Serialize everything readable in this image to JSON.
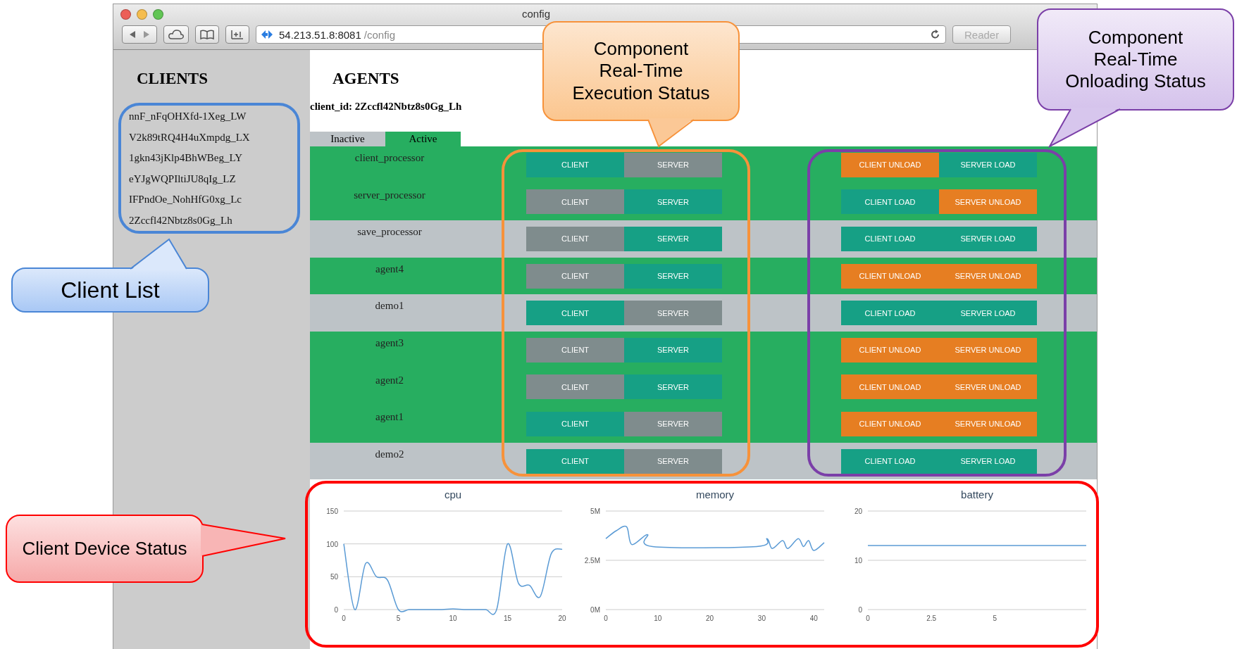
{
  "window": {
    "title": "config",
    "url_host": "54.213.51.8:8081",
    "url_path": "/config",
    "reader": "Reader"
  },
  "clients": {
    "heading": "CLIENTS",
    "items": [
      "nnF_nFqOHXfd-1Xeg_LW",
      "V2k89tRQ4H4uXmpdg_LX",
      "1gkn43jKlp4BhWBeg_LY",
      "eYJgWQPIltiJU8qIg_LZ",
      "IFPndOe_NohHfG0xg_Lc",
      "2Zccfl42Nbtz8s0Gg_Lh"
    ]
  },
  "agents": {
    "heading": "AGENTS",
    "client_id": "client_id: 2Zccfl42Nbtz8s0Gg_Lh",
    "tabs": [
      {
        "label": "Inactive",
        "selected": false
      },
      {
        "label": "Active",
        "selected": true
      }
    ],
    "rows": [
      {
        "name": "client_processor",
        "active": true,
        "execution": [
          {
            "label": "CLIENT",
            "selected": true
          },
          {
            "label": "SERVER",
            "selected": false
          }
        ],
        "onloading": [
          {
            "label": "CLIENT UNLOAD",
            "kind": "unload"
          },
          {
            "label": "SERVER LOAD",
            "kind": "load"
          }
        ]
      },
      {
        "name": "server_processor",
        "active": true,
        "execution": [
          {
            "label": "CLIENT",
            "selected": false
          },
          {
            "label": "SERVER",
            "selected": true
          }
        ],
        "onloading": [
          {
            "label": "CLIENT LOAD",
            "kind": "load"
          },
          {
            "label": "SERVER UNLOAD",
            "kind": "unload"
          }
        ]
      },
      {
        "name": "save_processor",
        "active": false,
        "execution": [
          {
            "label": "CLIENT",
            "selected": false
          },
          {
            "label": "SERVER",
            "selected": true
          }
        ],
        "onloading": [
          {
            "label": "CLIENT LOAD",
            "kind": "load"
          },
          {
            "label": "SERVER LOAD",
            "kind": "load"
          }
        ]
      },
      {
        "name": "agent4",
        "active": true,
        "execution": [
          {
            "label": "CLIENT",
            "selected": false
          },
          {
            "label": "SERVER",
            "selected": true
          }
        ],
        "onloading": [
          {
            "label": "CLIENT UNLOAD",
            "kind": "unload"
          },
          {
            "label": "SERVER UNLOAD",
            "kind": "unload"
          }
        ]
      },
      {
        "name": "demo1",
        "active": false,
        "execution": [
          {
            "label": "CLIENT",
            "selected": true
          },
          {
            "label": "SERVER",
            "selected": false
          }
        ],
        "onloading": [
          {
            "label": "CLIENT LOAD",
            "kind": "load"
          },
          {
            "label": "SERVER LOAD",
            "kind": "load"
          }
        ]
      },
      {
        "name": "agent3",
        "active": true,
        "execution": [
          {
            "label": "CLIENT",
            "selected": false
          },
          {
            "label": "SERVER",
            "selected": true
          }
        ],
        "onloading": [
          {
            "label": "CLIENT UNLOAD",
            "kind": "unload"
          },
          {
            "label": "SERVER UNLOAD",
            "kind": "unload"
          }
        ]
      },
      {
        "name": "agent2",
        "active": true,
        "execution": [
          {
            "label": "CLIENT",
            "selected": false
          },
          {
            "label": "SERVER",
            "selected": true
          }
        ],
        "onloading": [
          {
            "label": "CLIENT UNLOAD",
            "kind": "unload"
          },
          {
            "label": "SERVER UNLOAD",
            "kind": "unload"
          }
        ]
      },
      {
        "name": "agent1",
        "active": true,
        "execution": [
          {
            "label": "CLIENT",
            "selected": true
          },
          {
            "label": "SERVER",
            "selected": false
          }
        ],
        "onloading": [
          {
            "label": "CLIENT UNLOAD",
            "kind": "unload"
          },
          {
            "label": "SERVER UNLOAD",
            "kind": "unload"
          }
        ]
      },
      {
        "name": "demo2",
        "active": false,
        "execution": [
          {
            "label": "CLIENT",
            "selected": true
          },
          {
            "label": "SERVER",
            "selected": false
          }
        ],
        "onloading": [
          {
            "label": "CLIENT LOAD",
            "kind": "load"
          },
          {
            "label": "SERVER LOAD",
            "kind": "load"
          }
        ]
      }
    ]
  },
  "charts": [
    {
      "chart_data": {
        "type": "line",
        "title": "cpu",
        "x": [
          0,
          1,
          2,
          3,
          4,
          5,
          6,
          7,
          8,
          9,
          10,
          11,
          12,
          13,
          14,
          15,
          16,
          17,
          18,
          19,
          20
        ],
        "series": [
          {
            "color": "#5b9bd5",
            "values": [
              100,
              0,
              70,
              50,
              45,
              0,
              0,
              0,
              0,
              0,
              1,
              0,
              0,
              0,
              0,
              100,
              40,
              37,
              20,
              85,
              92
            ]
          }
        ],
        "xlim": [
          0,
          20
        ],
        "ylim": [
          0,
          150
        ],
        "xticks": [
          0,
          5,
          10,
          15,
          20
        ],
        "yticks": [
          0,
          50,
          100,
          150
        ]
      }
    },
    {
      "chart_data": {
        "type": "line",
        "title": "memory",
        "x": [
          0,
          2,
          4,
          5,
          8,
          9,
          29,
          31,
          32,
          34,
          35,
          37,
          38,
          39,
          40,
          42
        ],
        "series": [
          {
            "color": "#5b9bd5",
            "values": [
              3.6,
              4.0,
              4.2,
              3.3,
              3.8,
              3.2,
              3.2,
              3.6,
              3.1,
              3.5,
              3.1,
              3.6,
              3.2,
              3.5,
              3.0,
              3.4
            ]
          }
        ],
        "xlim": [
          0,
          42
        ],
        "ylim": [
          0,
          5
        ],
        "xticks": [
          0,
          10,
          20,
          30,
          40
        ],
        "yticks": [
          {
            "value": 0,
            "label": "0M"
          },
          {
            "value": 2.5,
            "label": "2.5M"
          },
          {
            "value": 5,
            "label": "5M"
          }
        ]
      }
    },
    {
      "chart_data": {
        "type": "line",
        "title": "battery",
        "x": [
          0,
          8.6
        ],
        "series": [
          {
            "color": "#5b9bd5",
            "values": [
              13,
              13
            ]
          }
        ],
        "xlim": [
          0,
          8.6
        ],
        "ylim": [
          0,
          20
        ],
        "xticks": [
          0,
          2.5,
          5
        ],
        "yticks": [
          0,
          10,
          20
        ]
      }
    }
  ],
  "callouts": [
    {
      "text": "Component\nReal-Time\nExecution Status",
      "color": "#f7923a"
    },
    {
      "text": "Component\nReal-Time\nOnloading Status",
      "color": "#7b3fa8"
    },
    {
      "text": "Client List",
      "color": "#4a86d6"
    },
    {
      "text": "Client Device Status",
      "color": "#ff0000"
    }
  ]
}
